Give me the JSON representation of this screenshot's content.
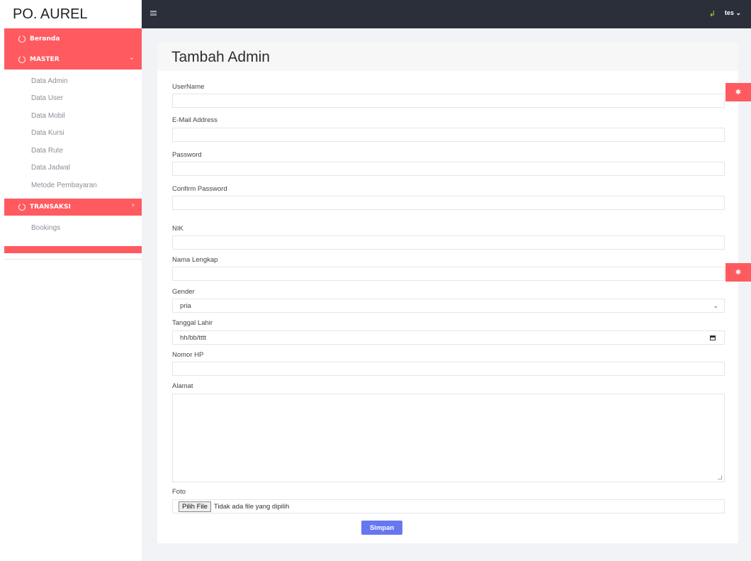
{
  "brand": "PO. AUREL",
  "sidebar": {
    "beranda": "Beranda",
    "master": {
      "label": "MASTER",
      "items": [
        "Data Admin",
        "Data User",
        "Data Mobil",
        "Data Kursi",
        "Data Rute",
        "Data Jadwal",
        "Metode Pembayaran"
      ]
    },
    "transaksi": {
      "label": "TRANSAKSI",
      "items": [
        "Bookings"
      ]
    }
  },
  "topbar": {
    "user": "tes"
  },
  "page": {
    "title": "Tambah Admin"
  },
  "form": {
    "username_label": "UserName",
    "email_label": "E-Mail Address",
    "password_label": "Password",
    "confirm_label": "Confirm Password",
    "nik_label": "NIK",
    "nama_label": "Nama Lengkap",
    "gender_label": "Gender",
    "gender_value": "pria",
    "tanggal_label": "Tanggal Lahir",
    "tanggal_placeholder": "hh/bb/tttt",
    "hp_label": "Nomor HP",
    "alamat_label": "Alamat",
    "foto_label": "Foto",
    "file_button": "Pilih File",
    "file_status": "Tidak ada file yang dipilih",
    "submit": "Simpan"
  },
  "colors": {
    "accent": "#ff5a5f",
    "topbar": "#2a2f3a",
    "primary_button": "#6777ef"
  }
}
